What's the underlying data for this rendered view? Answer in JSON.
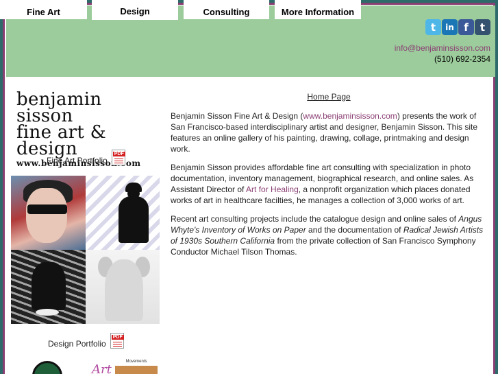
{
  "nav": {
    "tabs": [
      {
        "label": "Fine Art"
      },
      {
        "label": "Design"
      },
      {
        "label": "Consulting"
      },
      {
        "label": "More Information"
      }
    ]
  },
  "social": {
    "twitter": "t",
    "linkedin": "in",
    "facebook": "f",
    "tumblr": "t"
  },
  "contact": {
    "email": "info@benjaminsisson.com",
    "phone": "(510) 692-2354"
  },
  "logo": {
    "line1": "benjamin sisson",
    "line2": "fine art & design",
    "line3": "www.benjaminsisson.com"
  },
  "sidebar": {
    "fine_art_portfolio": "Fine Art Portfolio",
    "design_portfolio": "Design Portfolio",
    "pdf_label": "PDF",
    "thumb_swirl": "Art",
    "thumb_book_title": "Movements"
  },
  "main": {
    "home_link": "Home Page",
    "p1_a": "Benjamin Sisson Fine Art & Design (",
    "p1_link": "www.benjaminsisson.com",
    "p1_b": ") presents the work of San Francisco-based interdisciplinary artist and designer, Benjamin Sisson. This site features an online gallery of his painting, drawing, collage, printmaking and design work.",
    "p2_a": "Benjamin Sisson provides affordable fine art consulting with specialization in photo documentation, inventory management, biographical research, and online sales. As Assistant Director of ",
    "p2_link": "Art for Healing",
    "p2_b": ", a nonprofit organization which places donated works of art in healthcare facilties, he manages a collection of 3,000 works of art.",
    "p3_a": "Recent art consulting projects include the catalogue design and online sales of ",
    "p3_i1": "Angus Whyte's Inventory of Works on Paper",
    "p3_b": " and the documentation of ",
    "p3_i2": "Radical Jewish Artists of 1930s Southern California",
    "p3_c": " from the private collection of San Francisco Symphony Conductor Michael Tilson Thomas."
  }
}
